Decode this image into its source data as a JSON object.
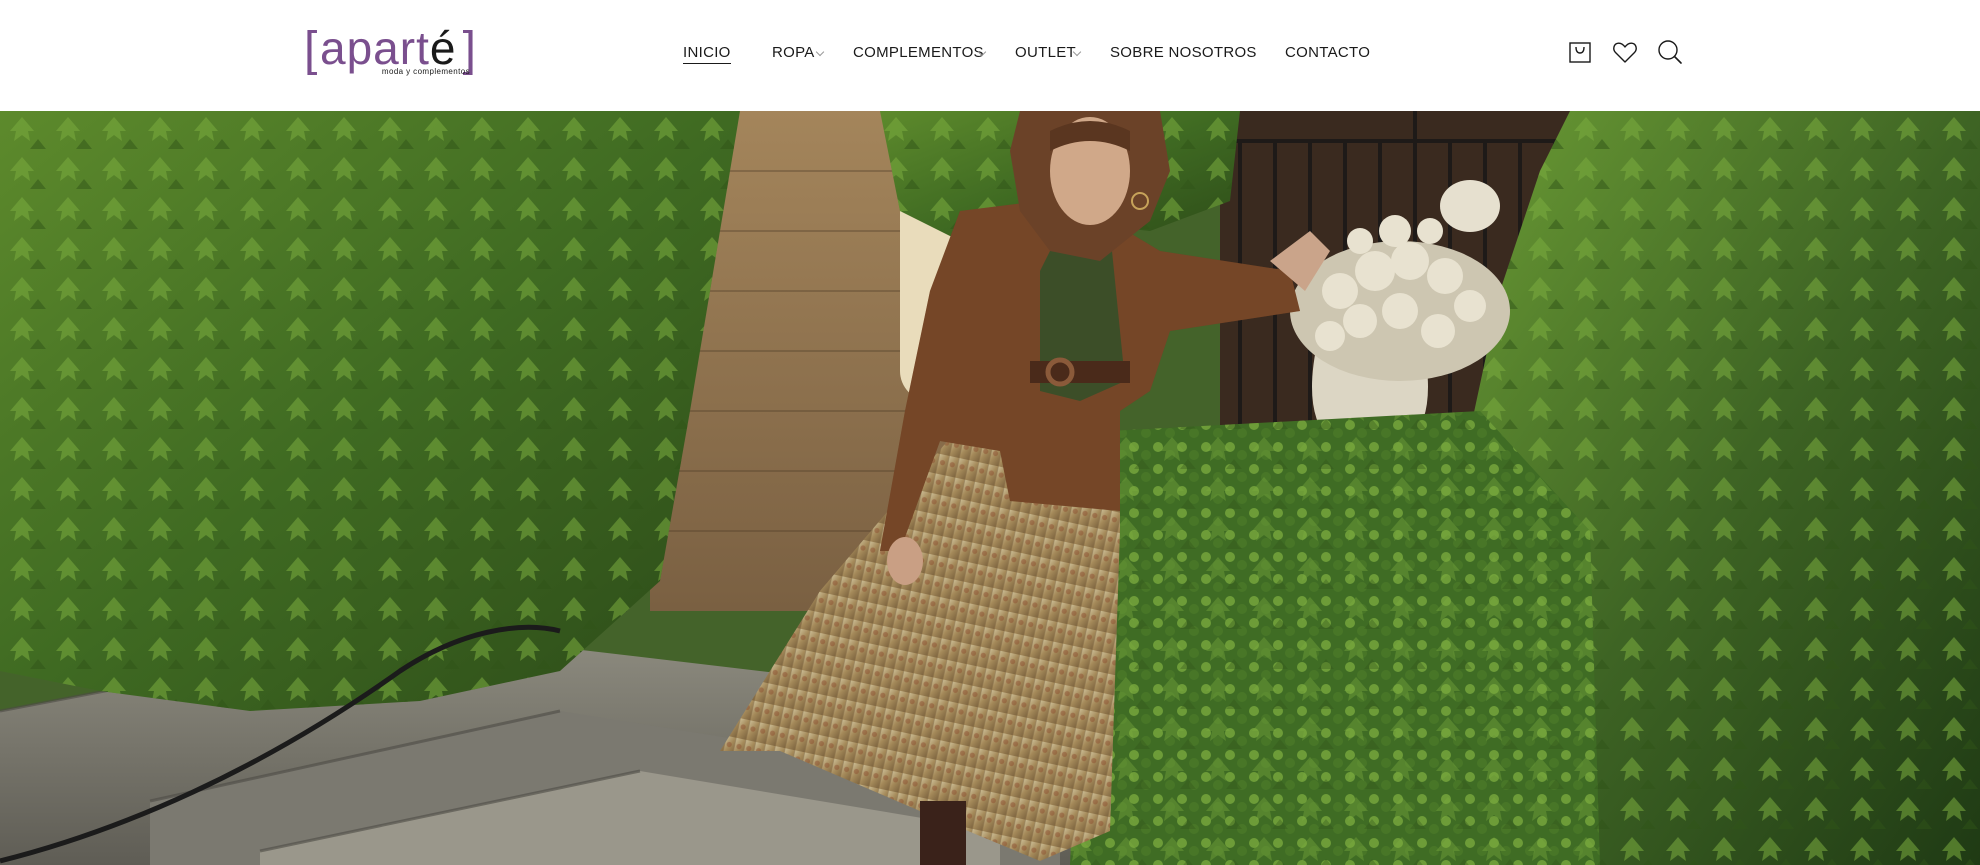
{
  "logo": {
    "bracket_left": "[",
    "part1": "apart",
    "part2": "é",
    "bracket_right": "]",
    "tagline": "moda y complementos",
    "brand_color": "#7a4f8e"
  },
  "nav": {
    "items": [
      {
        "label": "INICIO",
        "active": true,
        "has_dropdown": false
      },
      {
        "label": "ROPA",
        "active": false,
        "has_dropdown": true
      },
      {
        "label": "COMPLEMENTOS",
        "active": false,
        "has_dropdown": true
      },
      {
        "label": "OUTLET",
        "active": false,
        "has_dropdown": true
      },
      {
        "label": "SOBRE NOSOTROS",
        "active": false,
        "has_dropdown": false
      },
      {
        "label": "CONTACTO",
        "active": false,
        "has_dropdown": false
      }
    ]
  },
  "header_icons": [
    "cart-icon",
    "heart-icon",
    "search-icon"
  ],
  "hero": {
    "image_subject": "woman-in-brown-suede-jacket-and-floral-pleated-skirt-on-stone-steps-with-ivy"
  }
}
